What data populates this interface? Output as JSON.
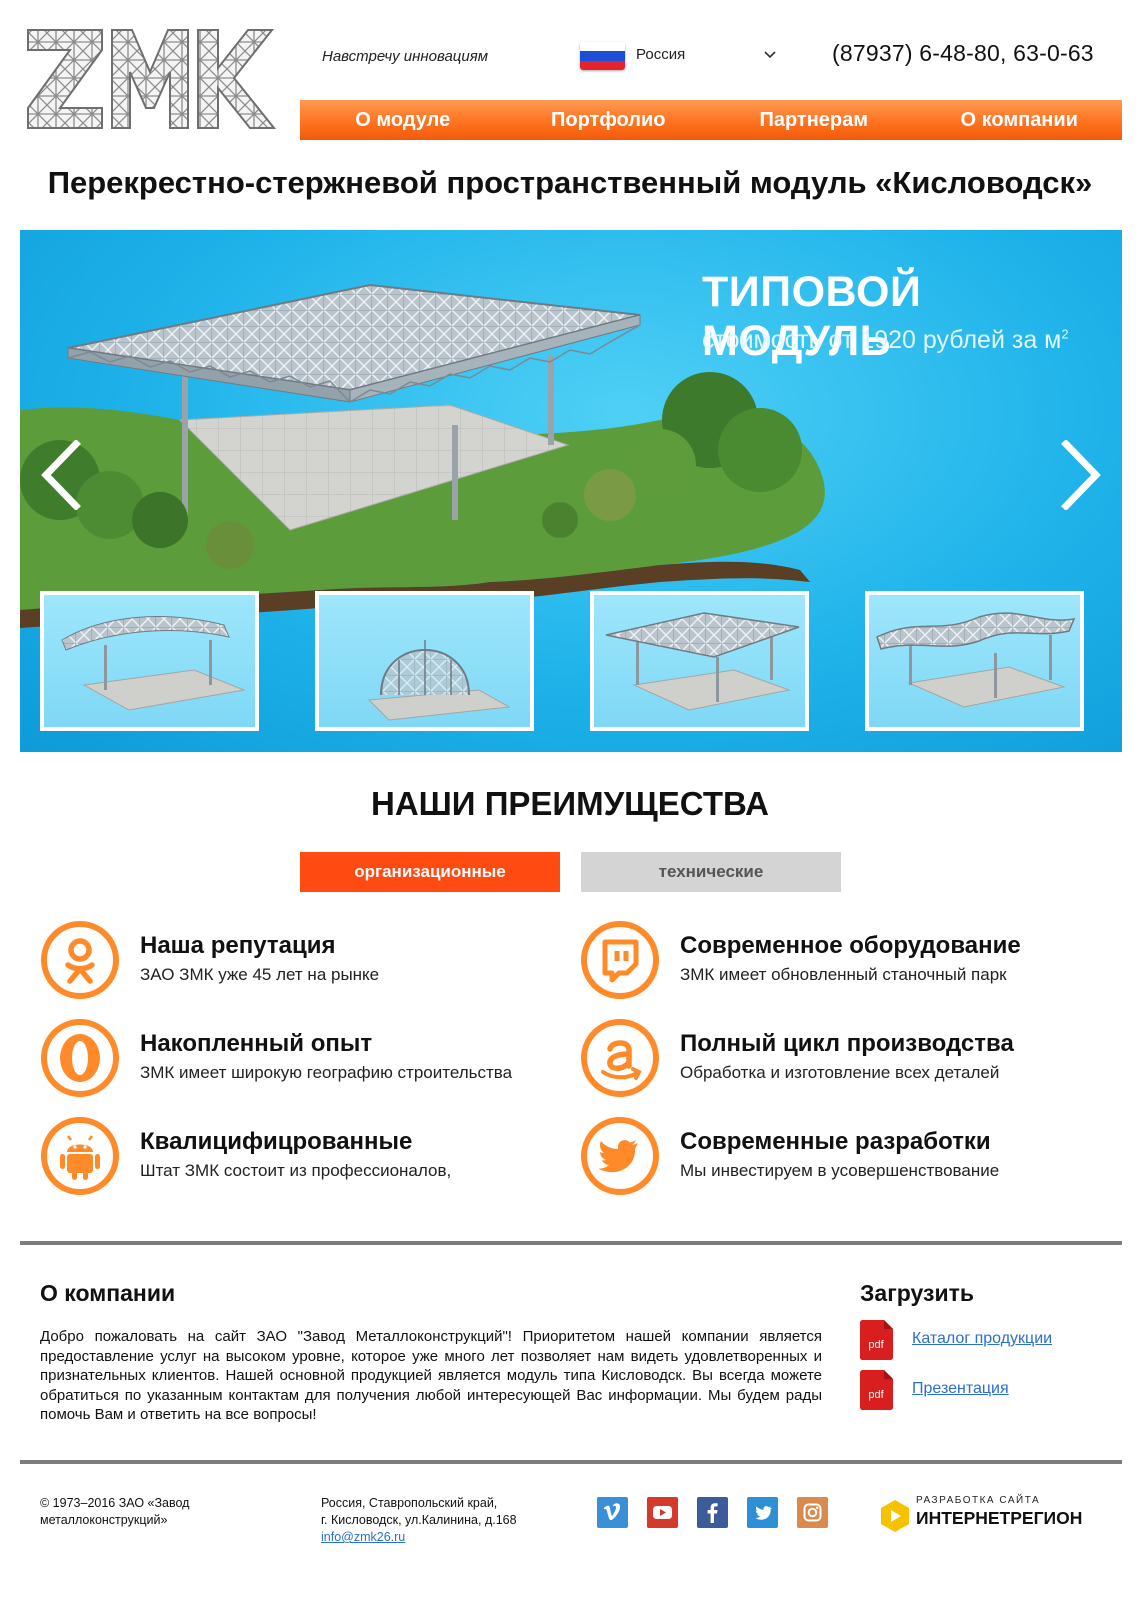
{
  "header": {
    "tagline": "Навстречу инновациям",
    "country": "Россия",
    "phone": "(87937) 6-48-80, 63-0-63"
  },
  "nav": {
    "items": [
      "О модуле",
      "Портфолио",
      "Партнерам",
      "О компании"
    ]
  },
  "page_title": "Перекрестно-стержневой пространственный модуль «Кисловодск»",
  "hero": {
    "title": "ТИПОВОЙ МОДУЛЬ",
    "subtitle": "стоимость от 1920 рублей за м",
    "subtitle_sup": "2"
  },
  "advantages": {
    "title": "НАШИ ПРЕИМУЩЕСТВА",
    "tabs": [
      "организационные",
      "технические"
    ],
    "active_tab": "организационные",
    "features": [
      {
        "icon": "odnoklassniki-icon",
        "title": "Наша репутация",
        "desc": "ЗАО ЗМК уже 45 лет на рынке"
      },
      {
        "icon": "twitch-icon",
        "title": "Современное оборудование",
        "desc": "ЗМК имеет обновленный станочный парк"
      },
      {
        "icon": "opera-icon",
        "title": "Накопленный опыт",
        "desc": "ЗМК имеет широкую географию строительства"
      },
      {
        "icon": "amazon-icon",
        "title": "Полный цикл производства",
        "desc": "Обработка и изготовление всех деталей"
      },
      {
        "icon": "android-icon",
        "title": "Квалицифицрованные",
        "desc": "Штат ЗМК состоит из профессионалов,"
      },
      {
        "icon": "twitter-icon",
        "title": "Современные разработки",
        "desc": "Мы инвестируем в усовершенствование"
      }
    ]
  },
  "about": {
    "title": "О компании",
    "text": "Добро пожаловать на сайт ЗАО \"Завод Металлоконструкций\"! Приоритетом нашей компании является предоставление услуг на высоком уровне, которое уже много лет позволяет нам видеть удовлетворенных и признательных клиентов. Нашей основной продукцией является модуль типа Кисловодск. Вы всегда можете обратиться по указанным контактам для получения любой интересующей Вас информации. Мы будем рады помочь Вам и ответить на все вопросы!"
  },
  "downloads": {
    "title": "Загрузить",
    "pdf_label": "pdf",
    "items": [
      "Каталог продукции",
      "Презентация"
    ]
  },
  "footer": {
    "copyright": "© 1973–2016 ЗАО «Завод металлоконструкций»",
    "address_line1": "Россия, Ставропольский край,",
    "address_line2": "г. Кисловодск, ул.Калинина, д.168",
    "email": "info@zmk26.ru",
    "social": [
      "vimeo-icon",
      "youtube-icon",
      "facebook-icon",
      "twitter-icon",
      "instagram-icon"
    ],
    "developer_small": "РАЗРАБОТКА САЙТА",
    "developer_name": "ИНТЕРНЕТРЕГИОН"
  },
  "colors": {
    "accent": "#ff6b1a",
    "tab_active": "#ff4a12",
    "tab_inactive": "#d4d4d4",
    "hero_sky": "#1fb3ea",
    "link": "#2a6fcf",
    "pdf_red": "#d81e1e"
  }
}
